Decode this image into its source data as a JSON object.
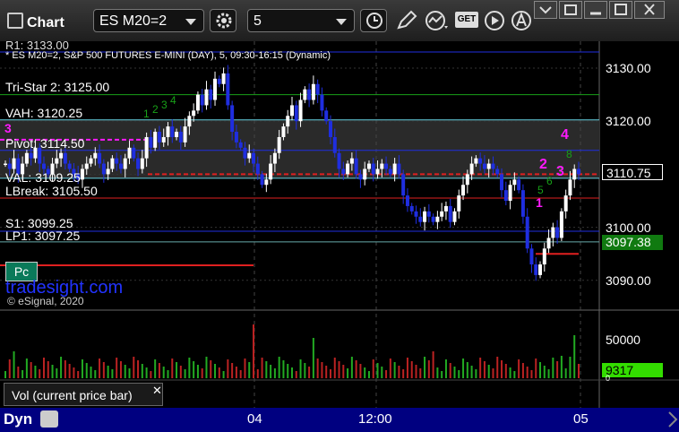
{
  "app": {
    "title": "Chart"
  },
  "toolbar": {
    "symbol": "ES M20=2",
    "interval": "5",
    "get_label": "GET"
  },
  "chart": {
    "header_line1": "R1: 3133.00",
    "header_line2": "* ES M20=2, S&P 500 FUTURES E-MINI (DAY), 5, 09:30-16:15 (Dynamic)",
    "levels": {
      "tristar": "Tri-Star 2: 3125.00",
      "vah": "VAH: 3120.25",
      "pivot": "Pivot: 3114.50",
      "val": "VAL: 3109.25",
      "lbreak": "LBreak: 3105.50",
      "s1": "S1: 3099.25",
      "lp1": "LP1: 3097.25"
    },
    "price_axis": [
      "3130.00",
      "3120.00",
      "3110.00",
      "3100.00",
      "3090.00"
    ],
    "last_price": "3110.75",
    "green_price": "3097.38",
    "pc_label": "Pc",
    "watermark": "tradesight.com",
    "copyright": "© eSignal, 2020",
    "seq_labels": [
      "3",
      "2",
      "3",
      "4",
      "1"
    ],
    "vol_axis": [
      "50000",
      "0"
    ],
    "vol_value": "9317",
    "vol_label": "Vol (current price bar)",
    "time_axis": [
      "04",
      "12:00",
      "05"
    ],
    "dyn_label": "Dyn",
    "colors": {
      "bg": "#000000",
      "up": "#ffffff",
      "down": "#1f2ee0",
      "pivot_line": "#1f2ee0",
      "level_cyan": "#66d0e0",
      "level_red": "#e02020",
      "accent_green": "#18a018",
      "magenta": "#ff19ff"
    }
  }
}
